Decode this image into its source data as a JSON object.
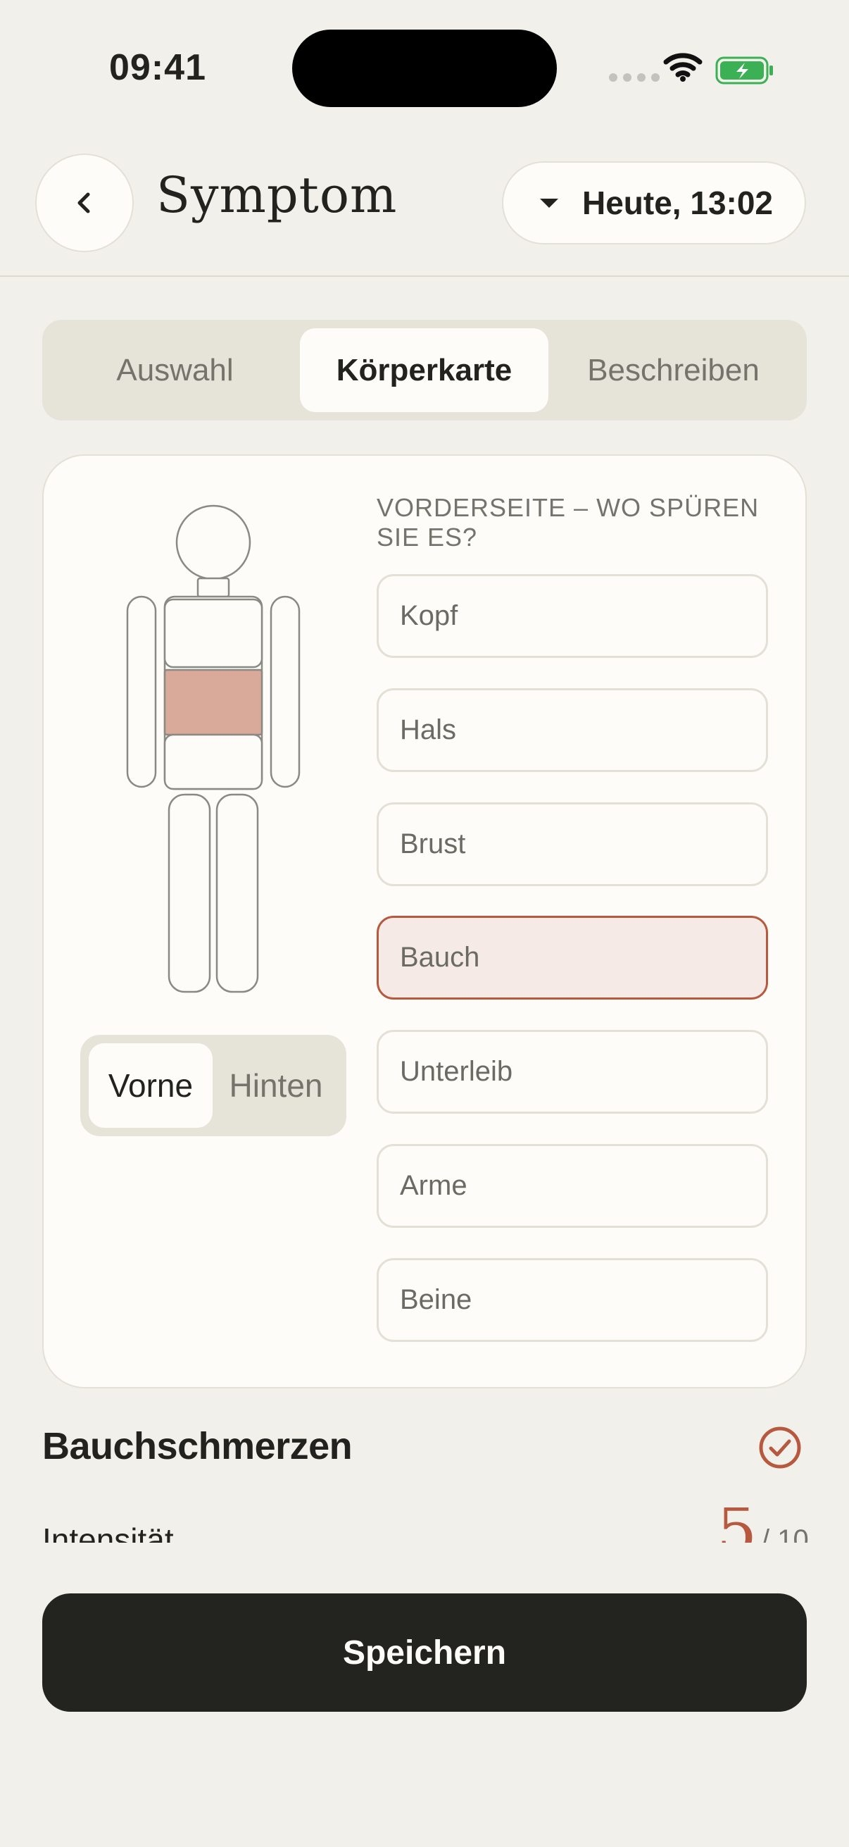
{
  "status_bar": {
    "time": "09:41"
  },
  "header": {
    "title": "Symptom",
    "date_selector": "Heute, 13:02"
  },
  "tabs": [
    {
      "label": "Auswahl",
      "active": false
    },
    {
      "label": "Körperkarte",
      "active": true
    },
    {
      "label": "Beschreiben",
      "active": false
    }
  ],
  "body_map": {
    "heading": "VORDERSEITE – WO SPÜREN SIE ES?",
    "highlight_color": "#d9a99a",
    "side_toggle": [
      {
        "label": "Vorne",
        "active": true
      },
      {
        "label": "Hinten",
        "active": false
      }
    ],
    "regions": [
      {
        "label": "Kopf",
        "selected": false
      },
      {
        "label": "Hals",
        "selected": false
      },
      {
        "label": "Brust",
        "selected": false
      },
      {
        "label": "Bauch",
        "selected": true
      },
      {
        "label": "Unterleib",
        "selected": false
      },
      {
        "label": "Arme",
        "selected": false
      },
      {
        "label": "Beine",
        "selected": false
      }
    ]
  },
  "summary": {
    "symptom_name": "Bauchschmerzen",
    "intensity_label": "Intensität",
    "intensity_value": "5",
    "intensity_max": "/ 10"
  },
  "actions": {
    "save_label": "Speichern"
  },
  "colors": {
    "accent": "#b7593f",
    "background": "#f2f0ea",
    "card": "#fdfcf8",
    "button_dark": "#23231f"
  }
}
